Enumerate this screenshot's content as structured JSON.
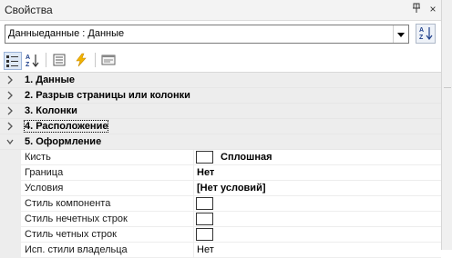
{
  "panel": {
    "title": "Свойства",
    "pin_glyph": "ф",
    "close_glyph": "×"
  },
  "selector": {
    "value": "Данныеданные : Данные"
  },
  "toolbar": {
    "icons": [
      "categorized-icon",
      "alphabetical-icon",
      "properties-icon",
      "events-icon",
      "property-pages-icon"
    ]
  },
  "categories": [
    {
      "label": "1. Данные",
      "expanded": false
    },
    {
      "label": "2. Разрыв страницы или колонки",
      "expanded": false
    },
    {
      "label": "3. Колонки",
      "expanded": false
    },
    {
      "label": "4. Расположение",
      "expanded": false
    },
    {
      "label": "5. Оформление",
      "expanded": true
    }
  ],
  "properties": [
    {
      "name": "Кисть",
      "value": "Сплошная",
      "swatch": true,
      "bold": true
    },
    {
      "name": "Граница",
      "value": "Нет",
      "swatch": false,
      "bold": true
    },
    {
      "name": "Условия",
      "value": "[Нет условий]",
      "swatch": false,
      "bold": true
    },
    {
      "name": "Стиль компонента",
      "value": "",
      "swatch": true,
      "bold": false
    },
    {
      "name": "Стиль нечетных строк",
      "value": "",
      "swatch": true,
      "bold": false
    },
    {
      "name": "Стиль четных строк",
      "value": "",
      "swatch": true,
      "bold": false
    },
    {
      "name": "Исп. стили владельца",
      "value": "Нет",
      "swatch": false,
      "bold": false
    }
  ],
  "colors": {
    "accent": "#1e3f8a",
    "grid_gutter": "#ededed"
  }
}
